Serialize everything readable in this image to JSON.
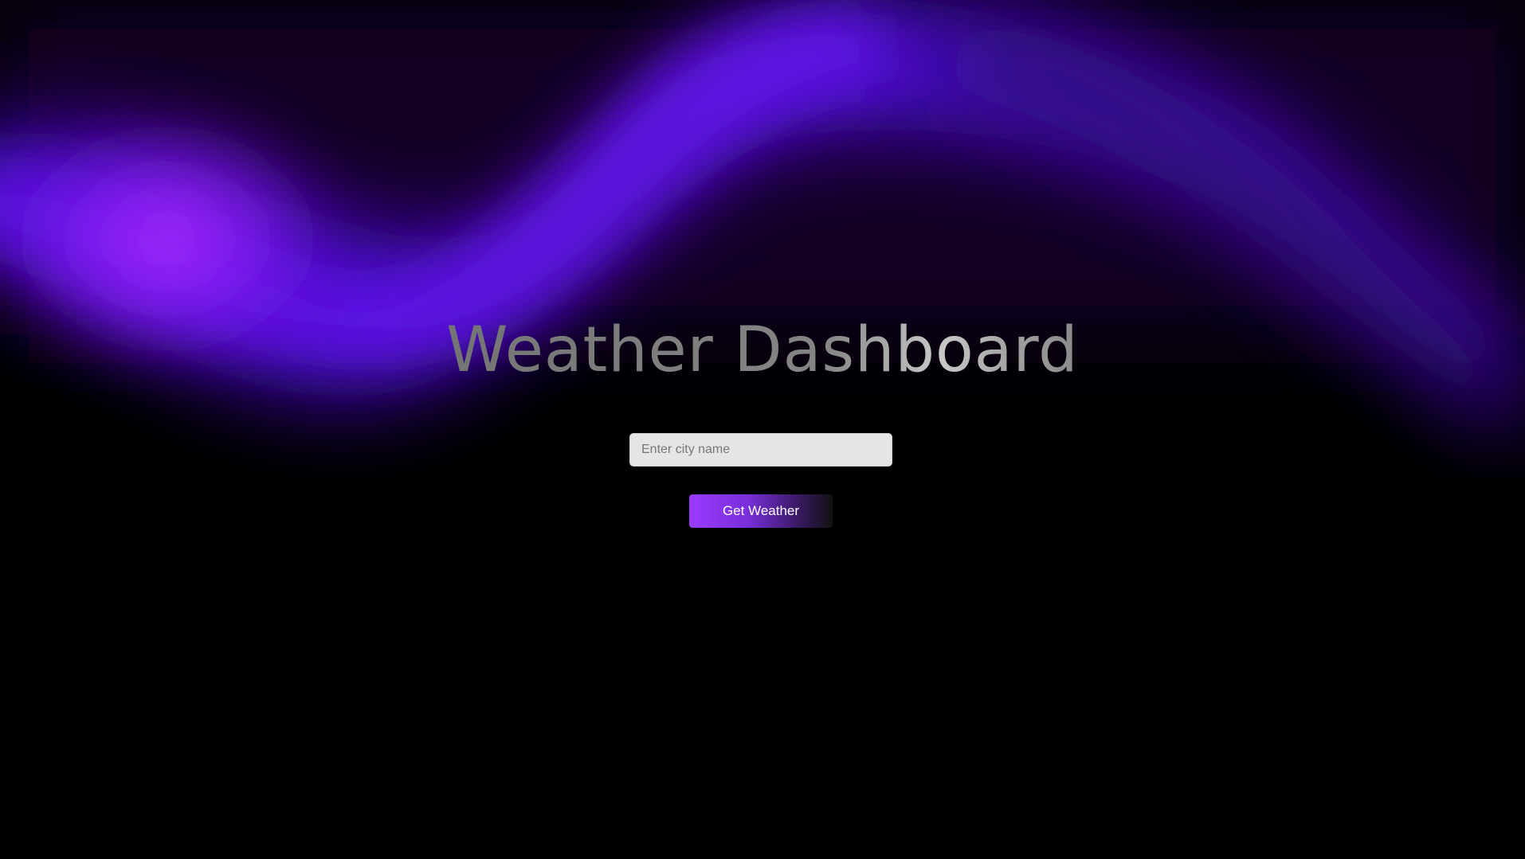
{
  "header": {
    "title": "Weather Dashboard"
  },
  "search": {
    "placeholder": "Enter city name",
    "value": ""
  },
  "actions": {
    "get_weather_label": "Get Weather"
  },
  "theme": {
    "background": "#000000",
    "aurora_primary": "#5a12e0",
    "aurora_highlight": "#a020ff",
    "button_gradient_start": "#9a3bff",
    "input_background": "#e5e5e5"
  }
}
